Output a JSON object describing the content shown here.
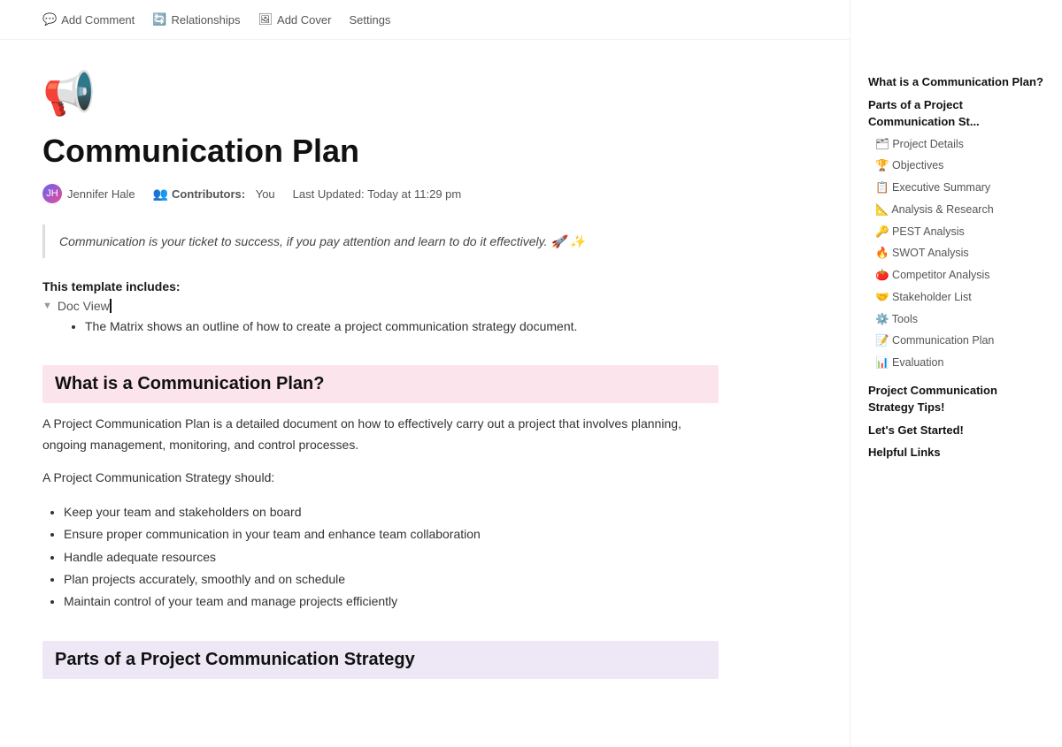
{
  "toolbar": {
    "add_comment": "Add Comment",
    "relationships": "Relationships",
    "add_cover": "Add Cover",
    "settings": "Settings"
  },
  "page": {
    "emoji": "📢",
    "title": "Communication Plan",
    "author_name": "Jennifer Hale",
    "contributors_label": "Contributors:",
    "contributors_value": "You",
    "last_updated_label": "Last Updated:",
    "last_updated_value": "Today at 11:29 pm",
    "quote": "Communication is your ticket to success, if you pay attention and learn to do it effectively. 🚀 ✨",
    "template_includes_label": "This template includes:",
    "doc_view_label": "Doc View",
    "template_list_item": "The Matrix shows an outline of how to create a project communication strategy document.",
    "section1_heading": "What is a Communication Plan?",
    "section1_para1": "A Project Communication Plan is a detailed document on how to effectively carry out a project that involves planning, ongoing management, monitoring, and control processes.",
    "section1_strategy_label": "A Project Communication Strategy should:",
    "section1_bullets": [
      "Keep your team and stakeholders on board",
      "Ensure proper communication in your team and enhance team collaboration",
      "Handle adequate resources",
      "Plan projects accurately, smoothly and on schedule",
      "Maintain control of your team and manage projects efficiently"
    ],
    "section2_heading": "Parts of a Project Communication Strategy"
  },
  "toc": {
    "items": [
      {
        "label": "What is a Communication Plan?",
        "level": "top"
      },
      {
        "label": "Parts of a Project Communication St...",
        "level": "top"
      },
      {
        "label": "🗂 Project Details",
        "level": "sub"
      },
      {
        "label": "🏆 Objectives",
        "level": "sub"
      },
      {
        "label": "📋 Executive Summary",
        "level": "sub"
      },
      {
        "label": "📐 Analysis & Research",
        "level": "sub"
      },
      {
        "label": "🔑 PEST Analysis",
        "level": "sub"
      },
      {
        "label": "🔥 SWOT Analysis",
        "level": "sub"
      },
      {
        "label": "🍅 Competitor Analysis",
        "level": "sub"
      },
      {
        "label": "🤝 Stakeholder List",
        "level": "sub"
      },
      {
        "label": "⚙️ Tools",
        "level": "sub"
      },
      {
        "label": "📝 Communication Plan",
        "level": "sub"
      },
      {
        "label": "📊 Evaluation",
        "level": "sub"
      },
      {
        "label": "Project Communication Strategy Tips!",
        "level": "top"
      },
      {
        "label": "Let's Get Started!",
        "level": "top"
      },
      {
        "label": "Helpful Links",
        "level": "top"
      }
    ]
  }
}
